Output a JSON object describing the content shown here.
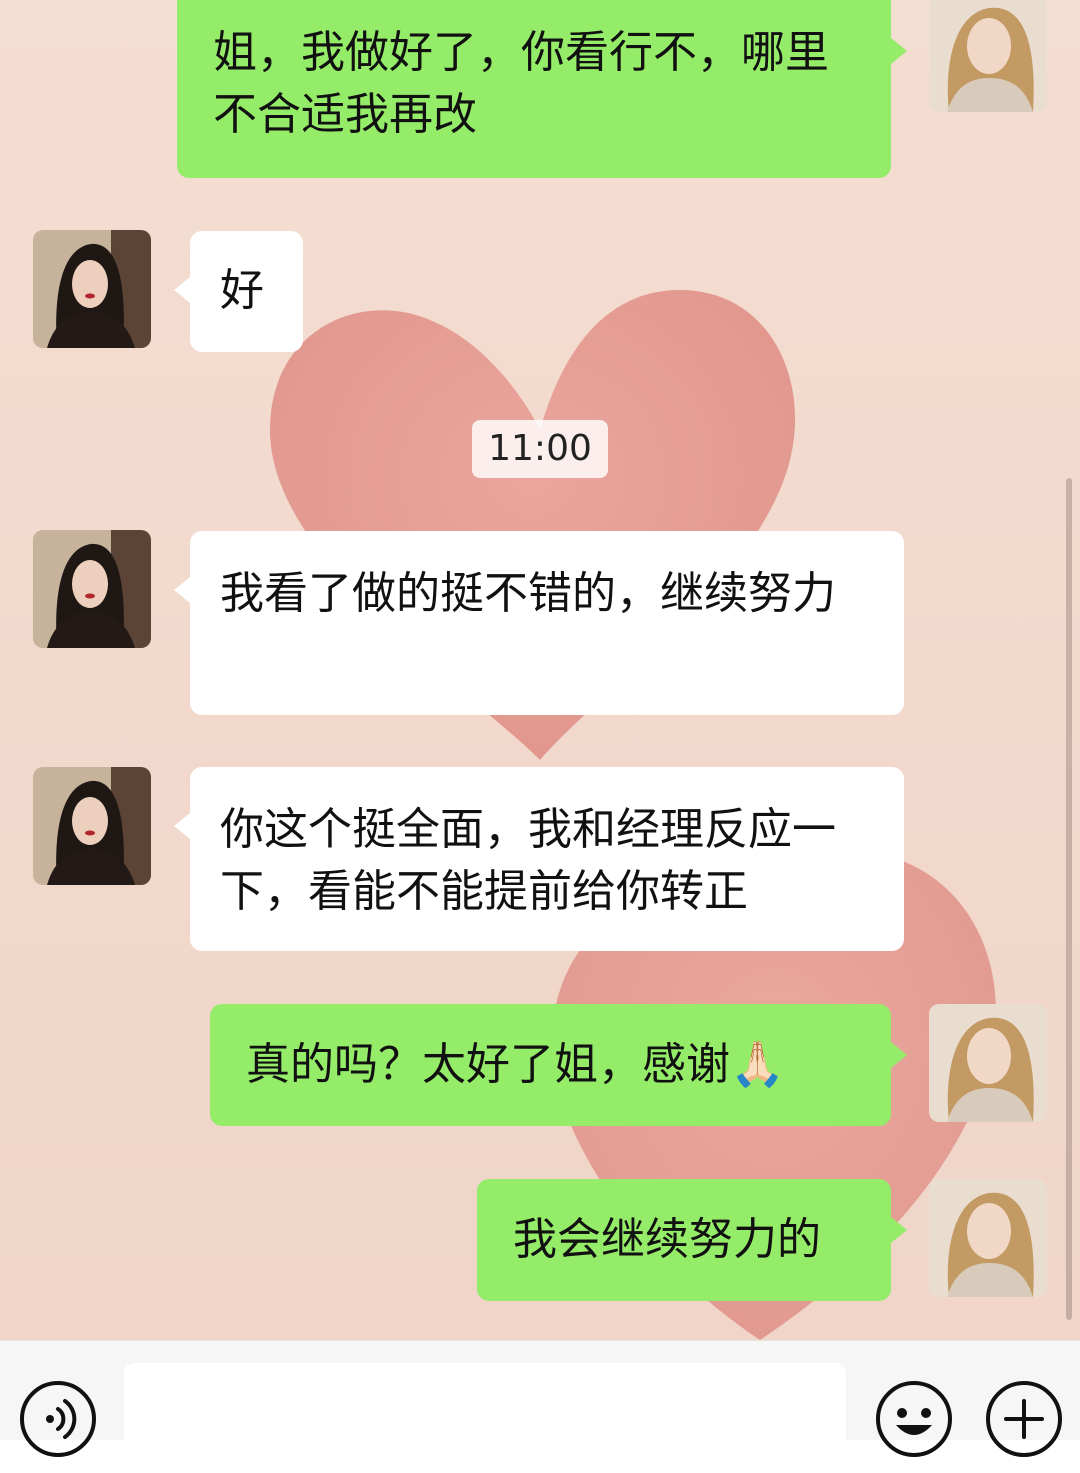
{
  "timestamp": "11:00",
  "messages": [
    {
      "side": "sent",
      "text": "姐，我做好了，你看行不，哪里不合适我再改",
      "avatar": "sender-avatar"
    },
    {
      "side": "received",
      "text": "好",
      "avatar": "contact-avatar"
    },
    {
      "side": "received",
      "text": "我看了做的挺不错的，继续努力",
      "avatar": "contact-avatar"
    },
    {
      "side": "received",
      "text": "你这个挺全面，我和经理反应一下，看能不能提前给你转正",
      "avatar": "contact-avatar"
    },
    {
      "side": "sent",
      "text": "真的吗？太好了姐，感谢",
      "emoji": "🙏🏻",
      "avatar": "sender-avatar"
    },
    {
      "side": "sent",
      "text": "我会继续努力的",
      "avatar": "sender-avatar"
    }
  ],
  "input_bar": {
    "text_value": "",
    "icons": [
      "voice-icon",
      "emoji-icon",
      "plus-icon"
    ]
  },
  "colors": {
    "sent_bubble": "#95ec69",
    "received_bubble": "#ffffff",
    "chat_background": "#f2d9cc",
    "input_bar": "#f6f6f6"
  }
}
